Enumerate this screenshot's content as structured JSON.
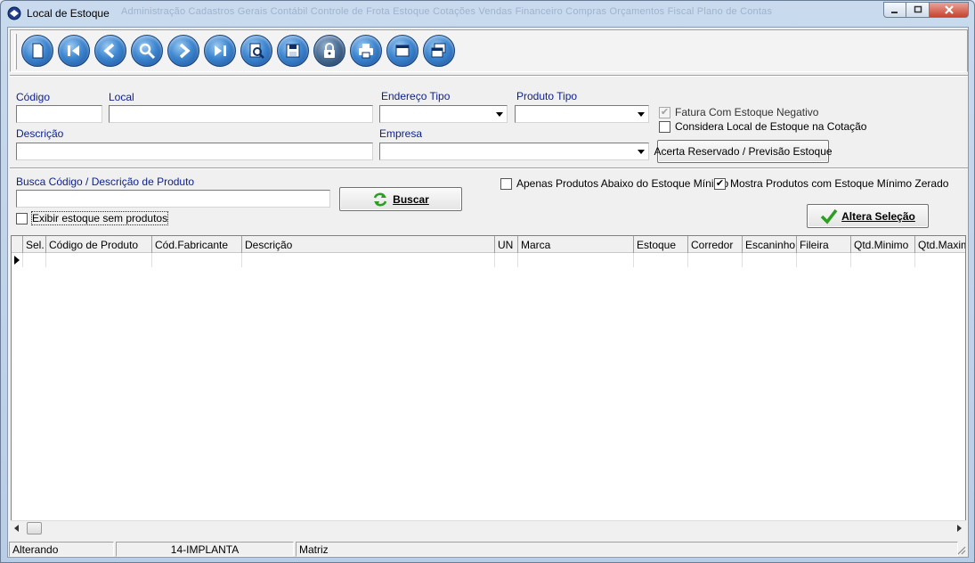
{
  "window": {
    "title": "Local de Estoque",
    "ghost_menu": "Administração   Cadastros Gerais   Contábil   Controle de Frota   Estoque   Cotações   Vendas   Financeiro   Compras   Orçamentos   Fiscal   Plano de Contas",
    "controls": [
      "minimize",
      "maximize",
      "close"
    ]
  },
  "toolbar": {
    "buttons": [
      {
        "icon": "new-document-icon"
      },
      {
        "icon": "first-record-icon"
      },
      {
        "icon": "previous-record-icon"
      },
      {
        "icon": "search-icon"
      },
      {
        "icon": "next-record-icon"
      },
      {
        "icon": "last-record-icon"
      },
      {
        "icon": "find-icon"
      },
      {
        "icon": "save-icon"
      },
      {
        "icon": "lock-icon"
      },
      {
        "icon": "print-icon"
      },
      {
        "icon": "window-icon"
      },
      {
        "icon": "copy-window-icon"
      }
    ]
  },
  "form": {
    "codigo_label": "Código",
    "codigo_value": "",
    "local_label": "Local",
    "local_value": "",
    "endereco_tipo_label": "Endereço Tipo",
    "endereco_tipo_value": "",
    "produto_tipo_label": "Produto Tipo",
    "produto_tipo_value": "",
    "descricao_label": "Descrição",
    "descricao_value": "",
    "empresa_label": "Empresa",
    "empresa_value": "",
    "fatura_negativo_label": "Fatura Com Estoque Negativo",
    "fatura_negativo_checked": true,
    "considera_cotacao_label": "Considera Local de Estoque na Cotação",
    "considera_cotacao_checked": false,
    "acerta_button": "Acerta Reservado / Previsão Estoque"
  },
  "search": {
    "label": "Busca Código / Descrição de Produto",
    "value": "",
    "buscar_button": "Buscar",
    "exibir_sem_produtos_label": "Exibir estoque sem produtos",
    "exibir_sem_produtos_checked": false,
    "apenas_abaixo_label": "Apenas Produtos Abaixo do Estoque Mínimo",
    "apenas_abaixo_checked": false,
    "mostra_zerado_label": "Mostra Produtos com Estoque Mínimo Zerado",
    "mostra_zerado_checked": true,
    "altera_button": "Altera Seleção"
  },
  "grid": {
    "columns": [
      "Sel.",
      "Código de Produto",
      "Cód.Fabricante",
      "Descrição",
      "UN",
      "Marca",
      "Estoque",
      "Corredor",
      "Escaninho",
      "Fileira",
      "Qtd.Minimo",
      "Qtd.Maximo"
    ],
    "rows": []
  },
  "status_bar": {
    "mode": "Alterando",
    "company_code": "14-IMPLANTA",
    "branch": "Matriz"
  },
  "colors": {
    "label_blue": "#0d1f8a",
    "frame_blue": "#c9daee",
    "check_green": "#2e9d23"
  }
}
